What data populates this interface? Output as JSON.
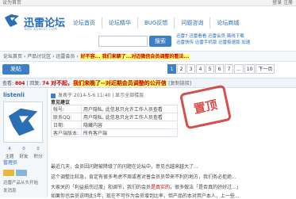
{
  "topbar": {
    "left": "设为首页",
    "right": "登录 注册"
  },
  "header": {
    "logo_title": "迅雷论坛",
    "logo_sub": "BBS.XUNLEI.COM",
    "nav": [
      "论坛首页",
      "论坛精华",
      "BUG反馈",
      "问题咨询",
      "论坛商城"
    ],
    "search_placeholder": "",
    "search_button": "搜索",
    "hot_line1": "迅雷7 迅雷看看 迅雷会员 离线下载",
    "hot_line2": "迅雷快传 迅雷手机版 迅雷极速版 加速"
  },
  "breadcrumb": {
    "path": "论坛首页 › 产品讨论区 › 迅雷会员 › ",
    "highlight": "好不容... 我们来聊了...对迈微信会员调整的看法..."
  },
  "toolbar": {
    "reply_label": "发帖",
    "pages": [
      "1",
      "2",
      "3",
      "4",
      "5",
      "6",
      "7",
      "...",
      "10",
      "下一页"
    ],
    "current_page": "1"
  },
  "stats": {
    "views_label": "查看:",
    "views": "804",
    "replies_label": "回复:",
    "replies": "74"
  },
  "thread": {
    "prefix": "对不起，",
    "title": "我们来晚了--对近期会员调整的公开信",
    "copy": "[复制链接]"
  },
  "user": {
    "name": "listenli",
    "stats_labels": [
      "主题",
      "好友",
      "积分"
    ],
    "stats_values": [
      "4",
      "0",
      "0"
    ],
    "level": "管理员",
    "line1": "迅雷产品从头开始",
    "line2": "发消息"
  },
  "post": {
    "meta": "发表于 2014-5-6 11:40  |  显示全部楼层",
    "stamp": "置顶",
    "info_head": "意见建议",
    "info_rows": [
      {
        "k": "帐号:",
        "v": "用户隐私, 此信息只允许工作人员查看"
      },
      {
        "k": "联系QQ:",
        "v": "用户隐私, 此信息只允许工作人员查看"
      },
      {
        "k": "日期:",
        "v": "隐藏内容"
      },
      {
        "k": "客户端版本:",
        "v": "所有客户端"
      }
    ],
    "body1": "最近几天，会员因问题被降级了的问题在论坛中，意见也越来越大了...",
    "body2": "这个调整比较急，肯定有很多考虑不周或者对普会员员带来不利的地方，我们务必拒绝...",
    "body3_a": "大家关的「利益损伤过度」和调节，我们的会员",
    "body3_b": "是真实的",
    "body3_c": "，很多做法「是否真的好好过...」",
    "body4": "如果你也会员说明此5年，现在不可作为会员增到比率，但产品的本对用户本人，上一些..."
  }
}
